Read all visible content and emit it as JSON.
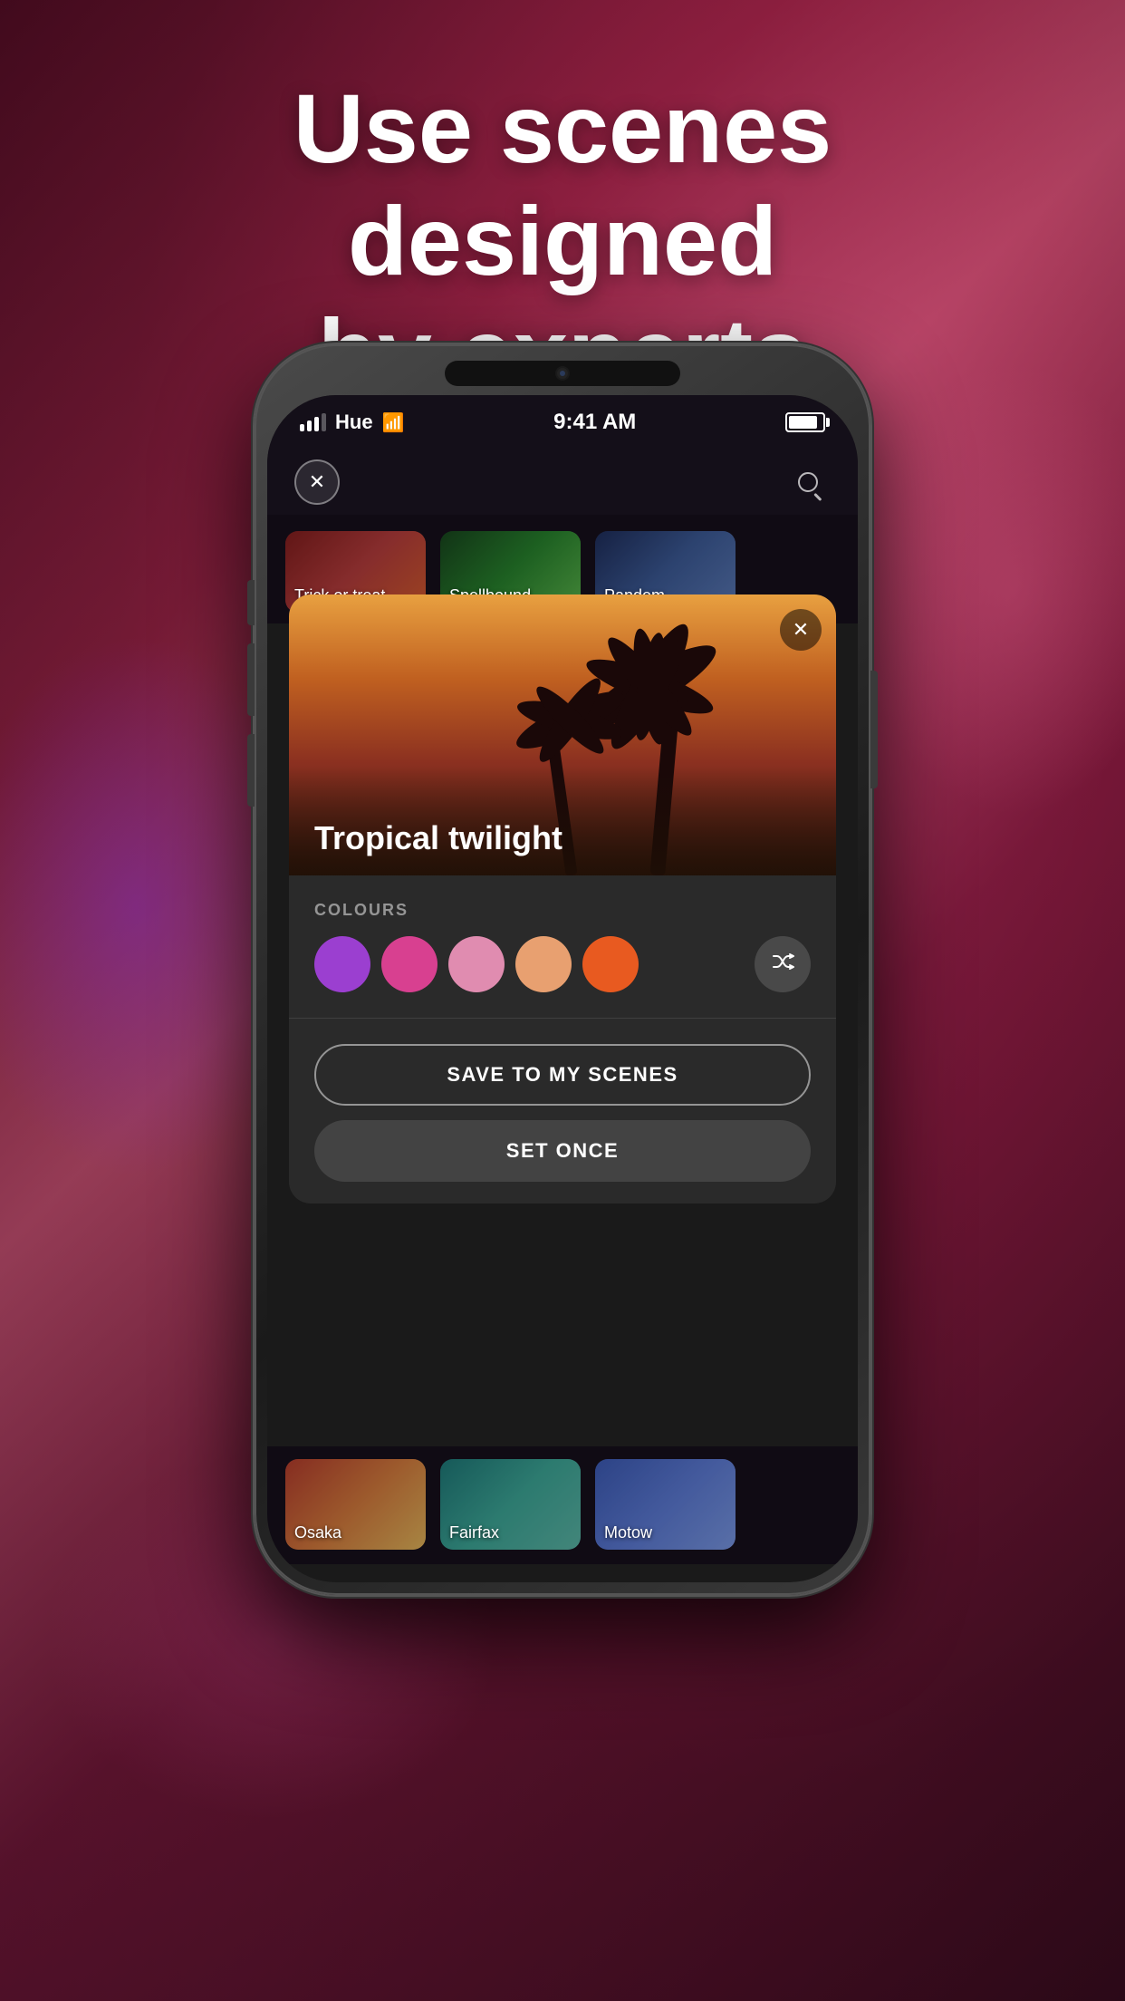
{
  "heading": {
    "line1": "Use scenes designed",
    "line2": "by experts"
  },
  "status_bar": {
    "carrier": "Hue",
    "time": "9:41 AM",
    "battery_label": "battery"
  },
  "app_header": {
    "close_label": "×",
    "search_label": "search"
  },
  "top_scenes": [
    {
      "name": "Trick or treat",
      "theme": "trick"
    },
    {
      "name": "Spellbound",
      "theme": "spell"
    },
    {
      "name": "Pandem",
      "theme": "pandem"
    }
  ],
  "modal": {
    "scene_name": "Tropical twilight",
    "close_label": "×",
    "colours_label": "COLOURS",
    "colours": [
      {
        "id": "purple",
        "hex": "#9b3fd0"
      },
      {
        "id": "pink-hot",
        "hex": "#d84090"
      },
      {
        "id": "pink-light",
        "hex": "#e08cb0"
      },
      {
        "id": "peach",
        "hex": "#e8a070"
      },
      {
        "id": "orange",
        "hex": "#e85a20"
      }
    ],
    "shuffle_icon": "⇌",
    "save_button_label": "SAVE TO MY SCENES",
    "set_once_button_label": "SET ONCE"
  },
  "bottom_scenes": [
    {
      "name": "Osaka",
      "theme": "osaka"
    },
    {
      "name": "Fairfax",
      "theme": "fairfax"
    },
    {
      "name": "Motow",
      "theme": "motown"
    }
  ]
}
